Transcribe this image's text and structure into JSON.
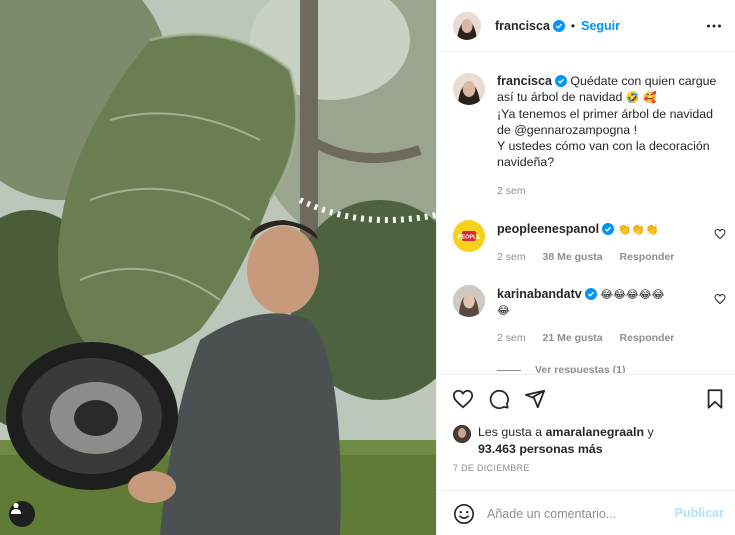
{
  "post": {
    "author": "francisca",
    "follow_label": "Seguir",
    "dot": "•"
  },
  "caption": {
    "author": "francisca",
    "line1": "Quédate con quien cargue",
    "line2": "así tu árbol de navidad",
    "line2_emoji": "🤣 🥰",
    "line3": "¡Ya tenemos el primer árbol de navidad",
    "line4": "de @gennarozampogna !",
    "line5": "Y ustedes cómo van con la decoración",
    "line6": "navideña?",
    "time": "2 sem"
  },
  "comments": [
    {
      "author": "peopleenespanol",
      "text": "👏👏👏",
      "time": "2 sem",
      "likes": "38 Me gusta",
      "reply_label": "Responder"
    },
    {
      "author": "karinabandatv",
      "text": "😂😂😂😂😂",
      "text2": "😂",
      "time": "2 sem",
      "likes": "21 Me gusta",
      "reply_label": "Responder"
    }
  ],
  "view_replies": "Ver respuestas (1)",
  "likes_summary": {
    "prefix": "Les gusta a",
    "user": "amaralanegraaln",
    "connector": "y",
    "others": "93.463 personas más"
  },
  "date": "7 DE DICIEMBRE",
  "add_comment": {
    "placeholder": "Añade un comentario...",
    "publish_label": "Publicar"
  },
  "colors": {
    "accent": "#0095f6",
    "publish_disabled": "#b2dffc",
    "muted": "#8e8e8e"
  },
  "icons": [
    "heart-icon",
    "comment-icon",
    "share-icon",
    "bookmark-icon",
    "emoji-icon",
    "more-options-icon",
    "verified-icon",
    "user-tag-icon"
  ]
}
